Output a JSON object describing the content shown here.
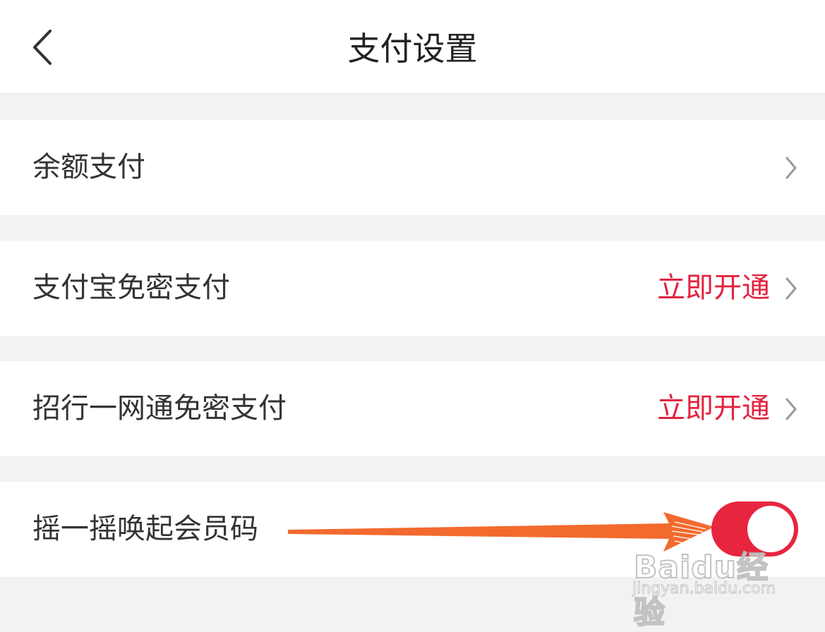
{
  "header": {
    "title": "支付设置",
    "back_icon": "chevron-left-icon"
  },
  "rows": [
    {
      "label": "余额支付",
      "action": "",
      "trailing_icon": "chevron-right-icon"
    },
    {
      "label": "支付宝免密支付",
      "action": "立即开通",
      "trailing_icon": "chevron-right-icon"
    },
    {
      "label": "招行一网通免密支付",
      "action": "立即开通",
      "trailing_icon": "chevron-right-icon"
    },
    {
      "label": "摇一摇唤起会员码",
      "toggle_on": true
    }
  ],
  "colors": {
    "accent": "#e3243f",
    "toggle_on": "#e8253e",
    "annotation_arrow": "#f26a2e",
    "background": "#f2f2f2"
  },
  "watermark": {
    "brand": "Baidu经验",
    "url": "jingyan.baidu.com"
  }
}
